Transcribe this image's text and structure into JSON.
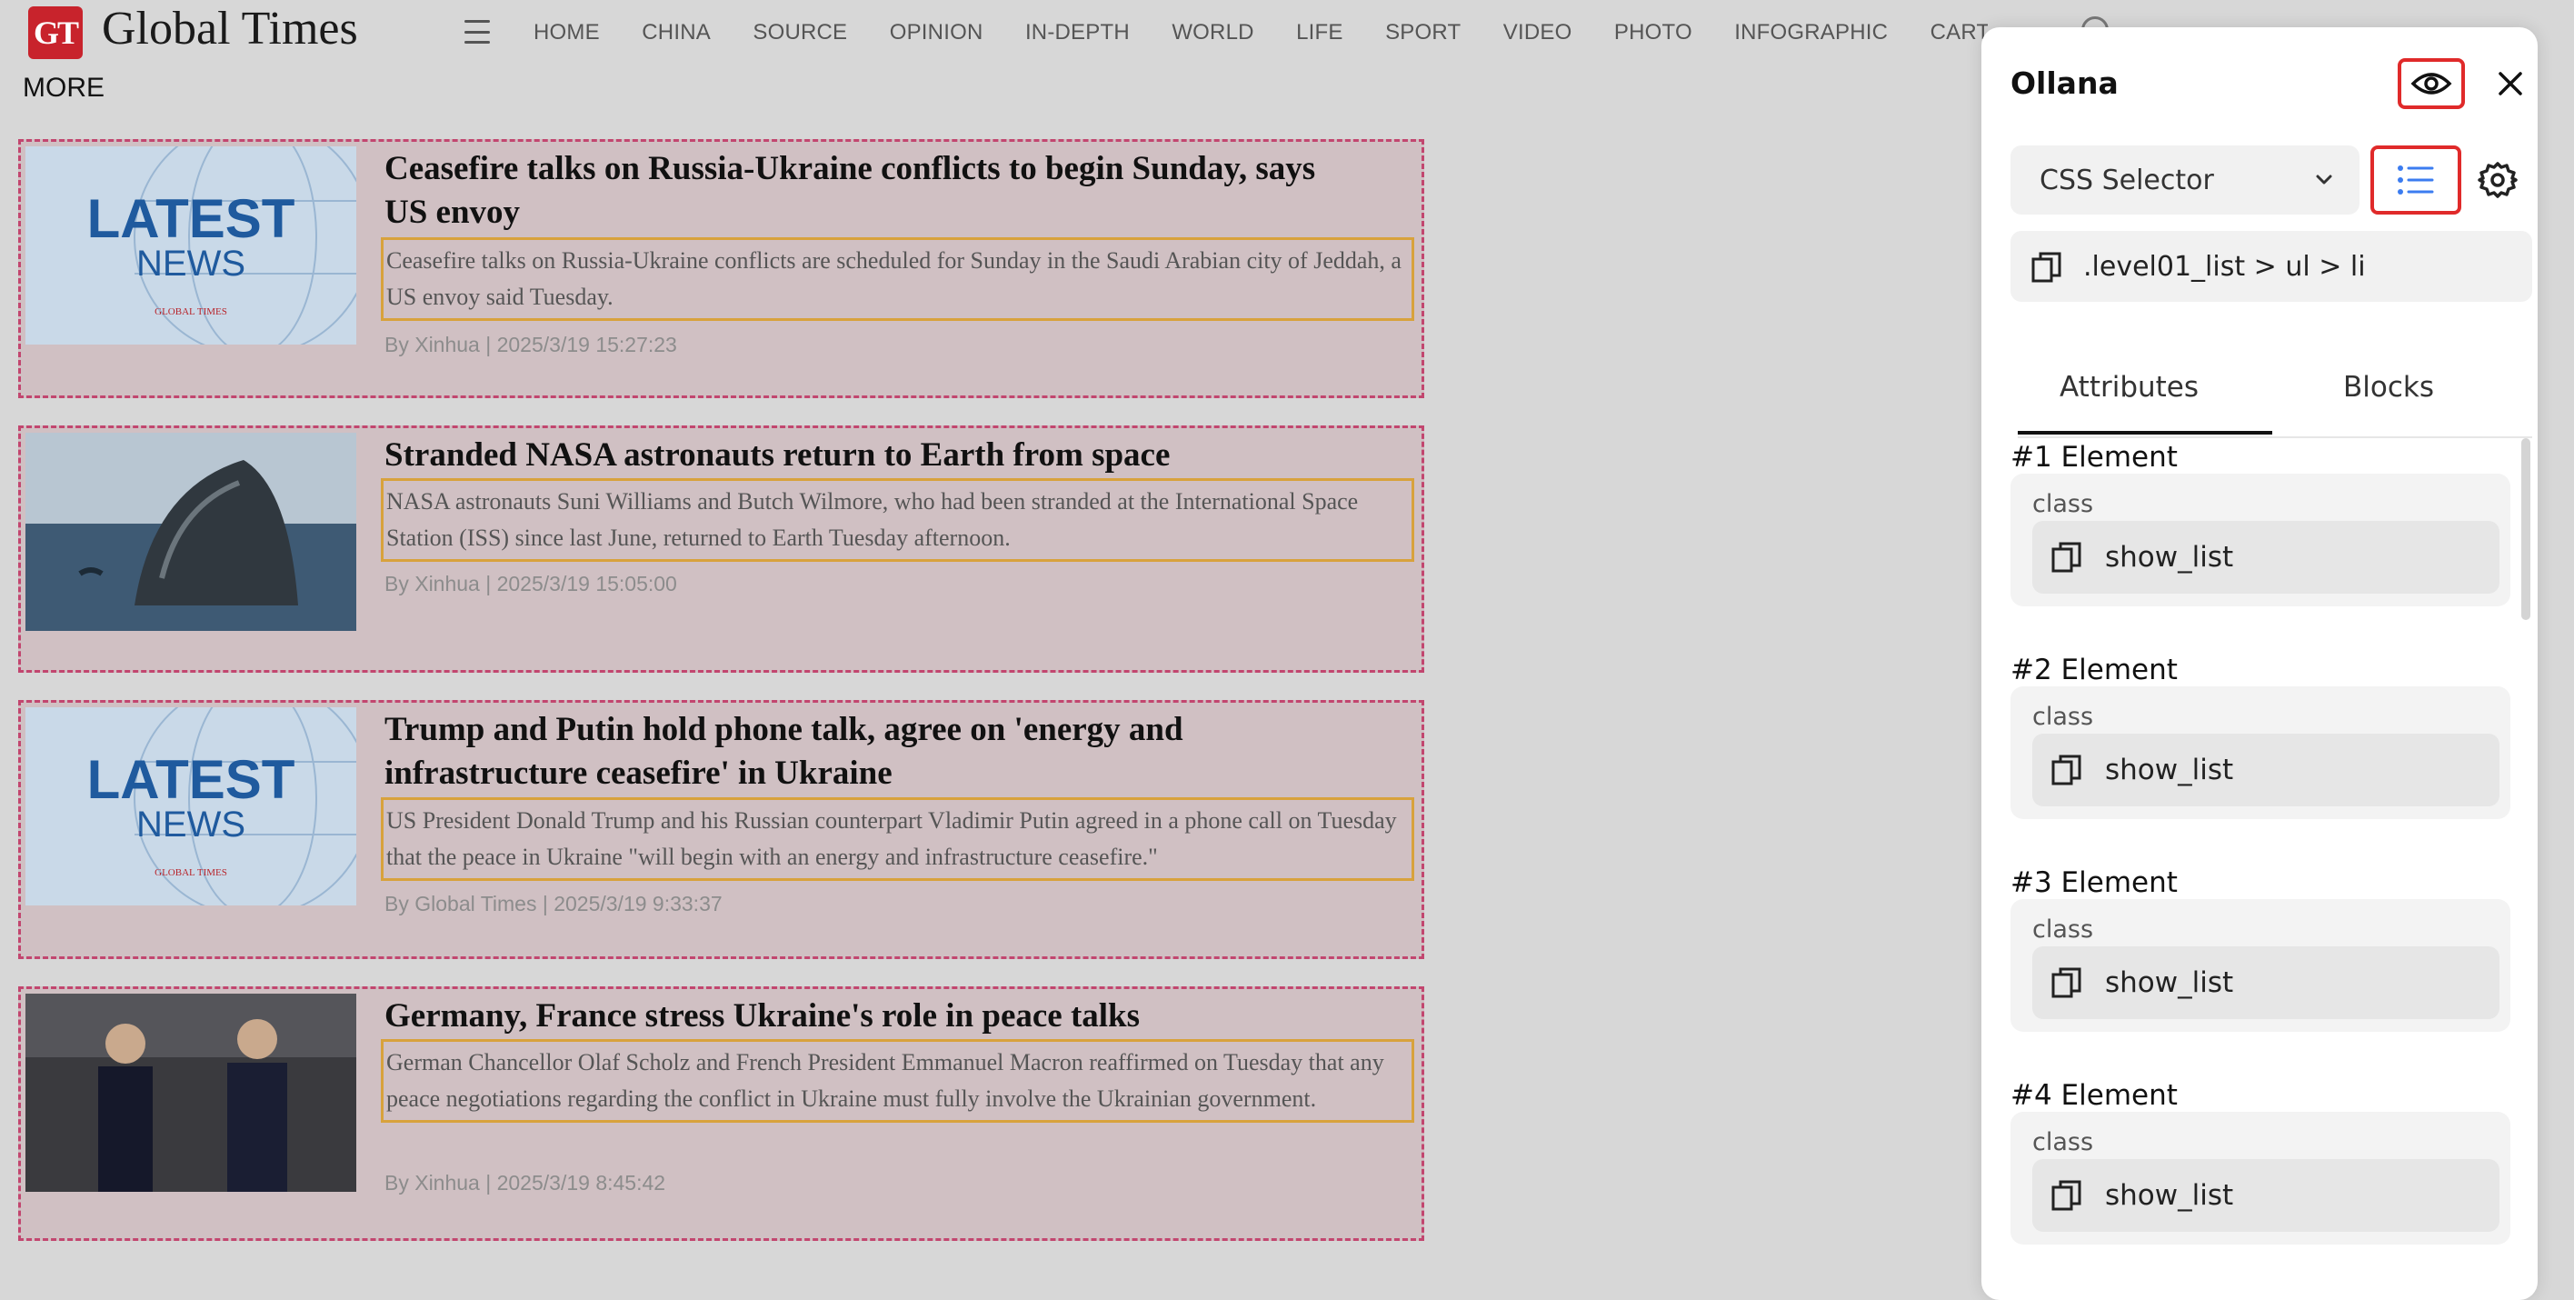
{
  "site": {
    "logo_badge": "GT",
    "logo_text": "Global Times",
    "nav": [
      "HOME",
      "CHINA",
      "SOURCE",
      "OPINION",
      "IN-DEPTH",
      "WORLD",
      "LIFE",
      "SPORT",
      "VIDEO",
      "PHOTO",
      "INFOGRAPHIC",
      "CARTOON"
    ],
    "more": "MORE"
  },
  "articles": [
    {
      "title": "Ceasefire talks on Russia-Ukraine conflicts to begin Sunday, says US envoy",
      "summary": "Ceasefire talks on Russia-Ukraine conflicts are scheduled for Sunday in the Saudi Arabian city of Jeddah, a US envoy said Tuesday.",
      "byline": "By Xinhua | 2025/3/19 15:27:23",
      "thumb": "latest-news",
      "thumb_text": "LATEST",
      "thumb_subtext": "NEWS",
      "thumb_brand": "GLOBAL TIMES"
    },
    {
      "title": "Stranded NASA astronauts return to Earth from space",
      "summary": "NASA astronauts Suni Williams and Butch Wilmore, who had been stranded at the International Space Station (ISS) since last June, returned to Earth Tuesday afternoon.",
      "byline": "By Xinhua | 2025/3/19 15:05:00",
      "thumb": "capsule"
    },
    {
      "title": "Trump and Putin hold phone talk, agree on 'energy and infrastructure ceasefire' in Ukraine",
      "summary": "US President Donald Trump and his Russian counterpart Vladimir Putin agreed in a phone call on Tuesday that the peace in Ukraine \"will begin with an energy and infrastructure ceasefire.\"",
      "byline": "By Global Times | 2025/3/19 9:33:37",
      "thumb": "latest-news",
      "thumb_text": "LATEST",
      "thumb_subtext": "NEWS",
      "thumb_brand": "GLOBAL TIMES"
    },
    {
      "title": "Germany, France stress Ukraine's role in peace talks",
      "summary": "German Chancellor Olaf Scholz and French President Emmanuel Macron reaffirmed on Tuesday that any peace negotiations regarding the conflict in Ukraine must fully involve the Ukrainian government.",
      "byline": "By Xinhua | 2025/3/19 8:45:42",
      "thumb": "leaders"
    }
  ],
  "panel": {
    "title": "Ollana",
    "selector_type": "CSS Selector",
    "selector_value": ".level01_list > ul > li",
    "tabs": [
      "Attributes",
      "Blocks"
    ],
    "active_tab": "Attributes",
    "elements": [
      {
        "heading": "#1 Element",
        "key": "class",
        "value": "show_list"
      },
      {
        "heading": "#2 Element",
        "key": "class",
        "value": "show_list"
      },
      {
        "heading": "#3 Element",
        "key": "class",
        "value": "show_list"
      },
      {
        "heading": "#4 Element",
        "key": "class",
        "value": "show_list"
      }
    ],
    "accent": "#3b7cf0",
    "highlight": "#e02a2a"
  }
}
